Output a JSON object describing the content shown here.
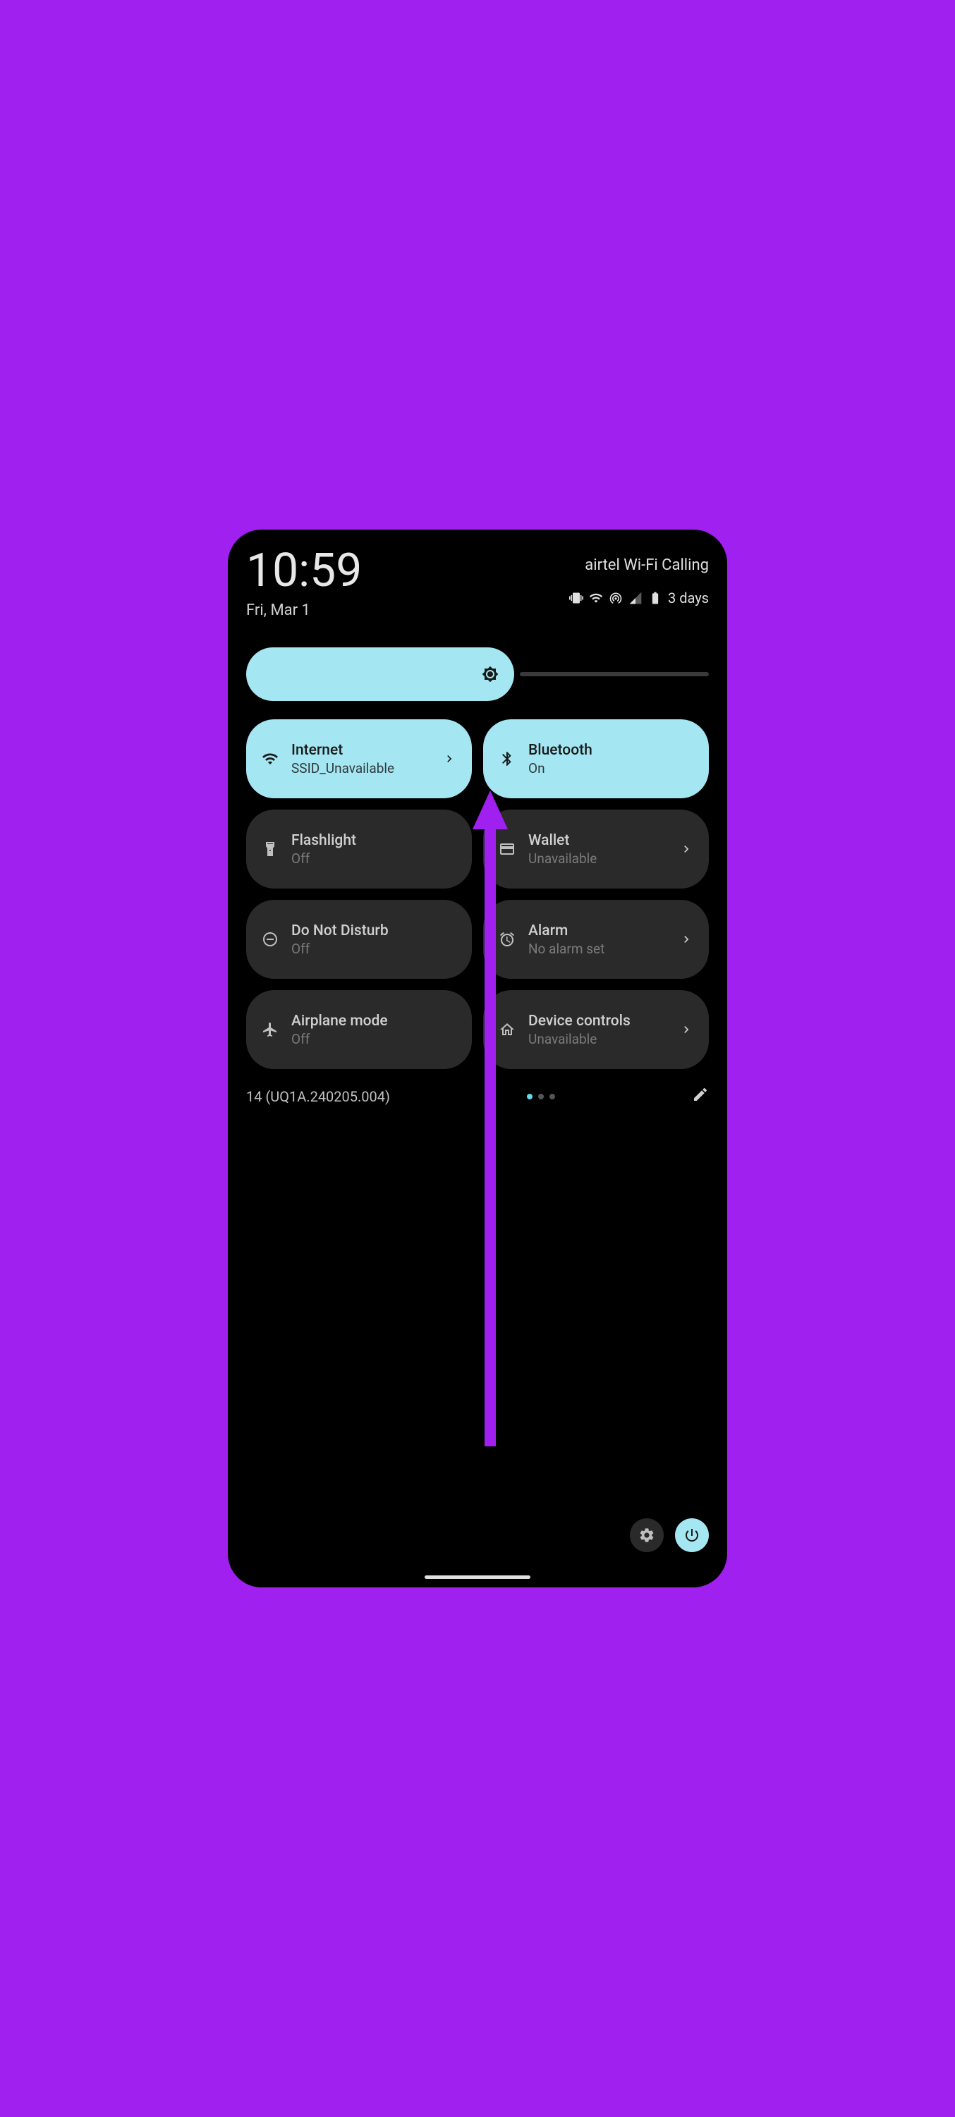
{
  "status": {
    "time": "10:59",
    "date": "Fri, Mar 1",
    "carrier": "airtel Wi-Fi Calling",
    "battery_text": "3 days"
  },
  "tiles": {
    "internet": {
      "title": "Internet",
      "sub": "SSID_Unavailable"
    },
    "bluetooth": {
      "title": "Bluetooth",
      "sub": "On"
    },
    "flashlight": {
      "title": "Flashlight",
      "sub": "Off"
    },
    "wallet": {
      "title": "Wallet",
      "sub": "Unavailable"
    },
    "dnd": {
      "title": "Do Not Disturb",
      "sub": "Off"
    },
    "alarm": {
      "title": "Alarm",
      "sub": "No alarm set"
    },
    "airplane": {
      "title": "Airplane mode",
      "sub": "Off"
    },
    "device": {
      "title": "Device controls",
      "sub": "Unavailable"
    }
  },
  "footer": {
    "build": "14 (UQ1A.240205.004)"
  },
  "colors": {
    "accent": "#a4e6f2",
    "tile_inactive": "#2a2a2a",
    "annotation": "#a020f0"
  }
}
